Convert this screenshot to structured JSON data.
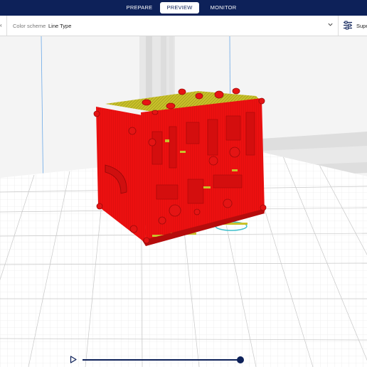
{
  "stages": {
    "prepare": "PREPARE",
    "preview": "PREVIEW",
    "monitor": "MONITOR",
    "active": "PREVIEW"
  },
  "toolbar": {
    "color_scheme_label": "Color scheme",
    "color_scheme_value": "Line Type",
    "settings_label": "Supe",
    "icons": {
      "left": "chevron-left-icon",
      "dropdown": "chevron-down-icon",
      "settings": "sliders-icon",
      "play": "play-icon"
    }
  },
  "viewport": {
    "model_color": "#ee1111",
    "infill_color": "#b8b81e",
    "build_plate_color": "#cfcfcf"
  },
  "layer_view": {
    "current_layer_fraction": 1.0
  }
}
